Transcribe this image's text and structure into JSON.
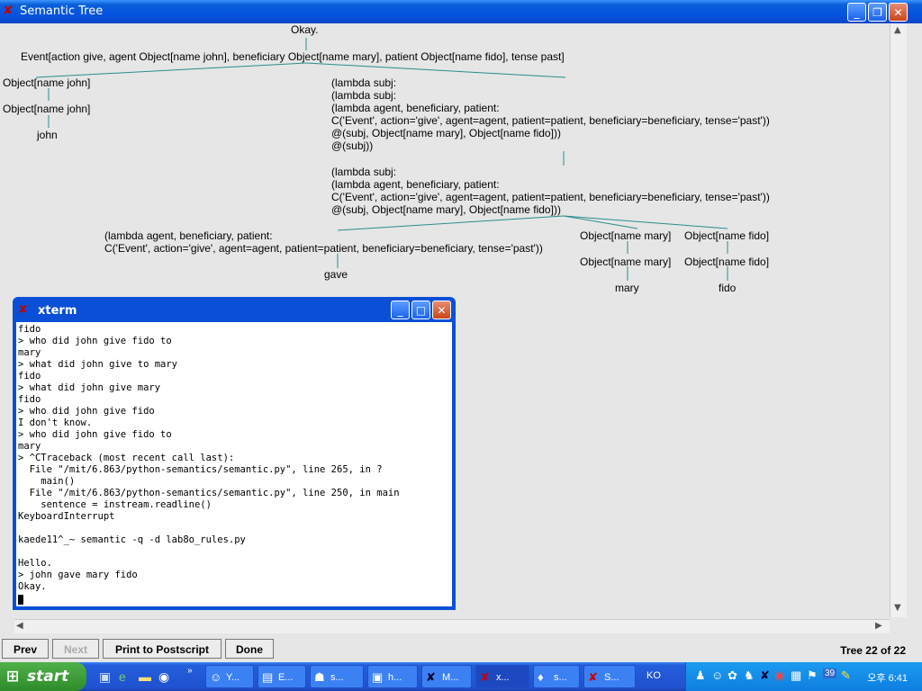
{
  "window": {
    "title": "Semantic Tree"
  },
  "tree": {
    "root": "Okay.",
    "event": "Event[action give, agent Object[name john], beneficiary Object[name mary], patient Object[name fido], tense past]",
    "left": [
      "Object[name john]",
      "Object[name john]",
      "john"
    ],
    "lambda1": [
      "(lambda subj:",
      "(lambda subj:",
      "(lambda agent, beneficiary, patient:",
      "C('Event', action='give', agent=agent, patient=patient, beneficiary=beneficiary, tense='past'))",
      "@(subj, Object[name mary], Object[name fido]))",
      "@(subj))"
    ],
    "lambda2": [
      "(lambda subj:",
      "(lambda agent, beneficiary, patient:",
      "C('Event', action='give', agent=agent, patient=patient, beneficiary=beneficiary, tense='past'))",
      "@(subj, Object[name mary], Object[name fido]))"
    ],
    "lambda3": [
      "(lambda agent, beneficiary, patient:",
      "C('Event', action='give', agent=agent, patient=patient, beneficiary=beneficiary, tense='past'))"
    ],
    "gave": "gave",
    "mary": [
      "Object[name mary]",
      "Object[name mary]",
      "mary"
    ],
    "fido": [
      "Object[name fido]",
      "Object[name fido]",
      "fido"
    ]
  },
  "toolbar": {
    "prev": "Prev",
    "next": "Next",
    "print": "Print to Postscript",
    "done": "Done",
    "tree_info": "Tree 22 of 22"
  },
  "xterm": {
    "title": "xterm",
    "text": "fido\n> who did john give fido to\nmary\n> what did john give to mary\nfido\n> what did john give mary\nfido\n> who did john give fido\nI don't know.\n> who did john give fido to\nmary\n> ^CTraceback (most recent call last):\n  File \"/mit/6.863/python-semantics/semantic.py\", line 265, in ?\n    main()\n  File \"/mit/6.863/python-semantics/semantic.py\", line 250, in main\n    sentence = instream.readline()\nKeyboardInterrupt\n\nkaede11^_~ semantic -q -d lab8o_rules.py\n\nHello.\n> john gave mary fido\nOkay."
  },
  "taskbar": {
    "start": "start",
    "tasks": [
      "Y...",
      "E...",
      "s...",
      "h...",
      "M...",
      "x...",
      "s...",
      "S..."
    ],
    "lang": "KO",
    "tray_badge": "39",
    "clock": "오후 6:41"
  },
  "colors": {
    "tree_line": "#2a8c8c",
    "title_blue": "#0554e0"
  }
}
